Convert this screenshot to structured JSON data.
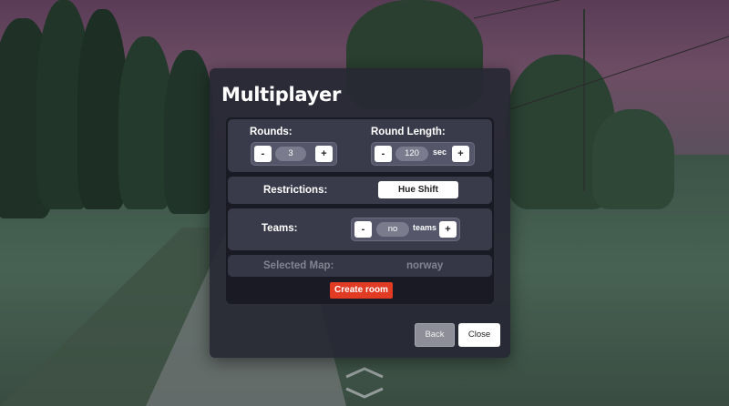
{
  "dialog": {
    "title": "Multiplayer",
    "rounds": {
      "label": "Rounds:",
      "value": "3",
      "dec": "-",
      "inc": "+"
    },
    "round_length": {
      "label": "Round Length:",
      "value": "120",
      "unit": "sec",
      "dec": "-",
      "inc": "+"
    },
    "restrictions": {
      "label": "Restrictions:",
      "value": "Hue Shift"
    },
    "teams": {
      "label": "Teams:",
      "value": "no",
      "unit": "teams",
      "dec": "-",
      "inc": "+"
    },
    "selected_map": {
      "label": "Selected Map:",
      "value": "norway"
    },
    "create_label": "Create room",
    "back_label": "Back",
    "close_label": "Close"
  },
  "colors": {
    "dialog_bg": "#272834",
    "card_bg": "#3a3b4a",
    "create_button": "#e23b24",
    "back_button": "#8d8e98"
  },
  "icons": {
    "nav_up": "chevron-up-icon",
    "nav_down": "chevron-down-icon"
  }
}
